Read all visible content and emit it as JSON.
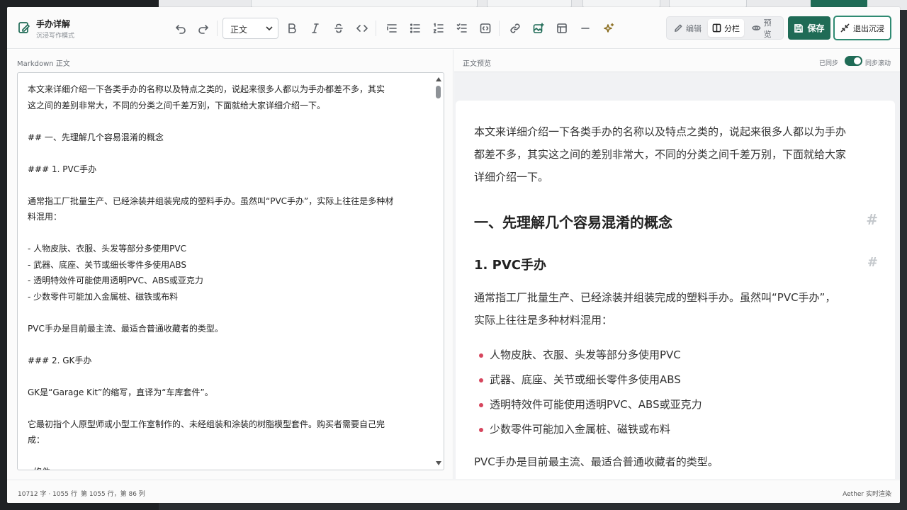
{
  "toolbar": {
    "title": "手办详解",
    "subtitle": "沉浸写作模式",
    "block_format": "正文",
    "view_modes": {
      "edit": "编辑",
      "split": "分栏",
      "preview": "预览"
    },
    "save_label": "保存",
    "exit_label": "退出沉浸",
    "accent_color": "#1f6b56"
  },
  "editor": {
    "label": "Markdown 正文",
    "lines": [
      "本文来详细介绍一下各类手办的名称以及特点之类的，说起来很多人都以为手办都差不多，其实",
      "这之间的差别非常大，不同的分类之间千差万别，下面就给大家详细介绍一下。",
      "",
      "## 一、先理解几个容易混淆的概念",
      "",
      "### 1. PVC手办",
      "",
      "通常指工厂批量生产、已经涂装并组装完成的塑料手办。虽然叫“PVC手办”，实际上往往是多种材",
      "料混用：",
      "",
      "- 人物皮肤、衣服、头发等部分多使用PVC",
      "- 武器、底座、关节或细长零件多使用ABS",
      "- 透明特效件可能使用透明PVC、ABS或亚克力",
      "- 少数零件可能加入金属桩、磁铁或布料",
      "",
      "PVC手办是目前最主流、最适合普通收藏者的类型。",
      "",
      "### 2. GK手办",
      "",
      "GK是“Garage Kit”的缩写，直译为“车库套件”。",
      "",
      "它最初指个人原型师或小型工作室制作的、未经组装和涂装的树脂模型套件。购买者需要自己完",
      "成：",
      "",
      "- 修件"
    ]
  },
  "preview": {
    "label": "正文预览",
    "synced": "已同步",
    "sync_scroll": "同步滚动",
    "intro_lines": [
      "本文来详细介绍一下各类手办的名称以及特点之类的，说起来很多人都以为手办",
      "都差不多，其实这之间的差别非常大，不同的分类之间千差万别，下面就给大家",
      "详细介绍一下。"
    ],
    "h2": "一、先理解几个容易混淆的概念",
    "h3": "1. PVC手办",
    "para_lines": [
      "通常指工厂批量生产、已经涂装并组装完成的塑料手办。虽然叫“PVC手办”，",
      "实际上往往是多种材料混用："
    ],
    "items": [
      "人物皮肤、衣服、头发等部分多使用PVC",
      "武器、底座、关节或细长零件多使用ABS",
      "透明特效件可能使用透明PVC、ABS或亚克力",
      "少数零件可能加入金属桩、磁铁或布料"
    ],
    "closing": "PVC手办是目前最主流、最适合普通收藏者的类型。",
    "anchor": "#"
  },
  "status": {
    "count": "10712 字 · 1055 行",
    "cursor": "第 1055 行，第 86 列",
    "engine": "Aether 实时渲染"
  }
}
